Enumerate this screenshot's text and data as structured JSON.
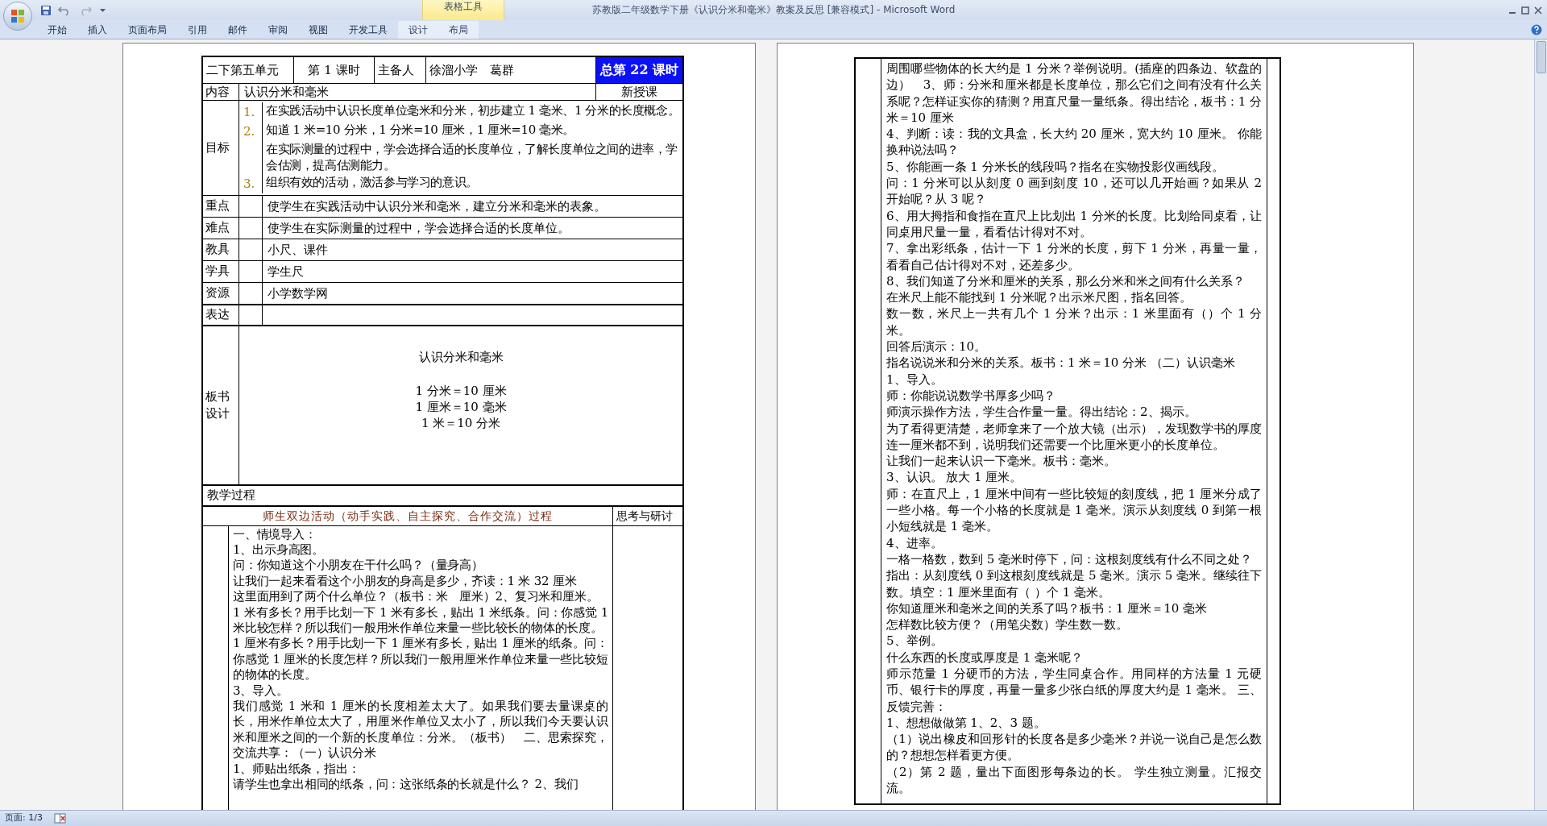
{
  "window": {
    "title": "苏教版二年级数学下册《认识分米和毫米》教案及反思 [兼容模式] - Microsoft Word",
    "contextual_group": "表格工具"
  },
  "ribbon_tabs": [
    {
      "label": "开始",
      "kind": "standard",
      "selected": false
    },
    {
      "label": "插入",
      "kind": "standard",
      "selected": false
    },
    {
      "label": "页面布局",
      "kind": "standard",
      "selected": false
    },
    {
      "label": "引用",
      "kind": "standard",
      "selected": false
    },
    {
      "label": "邮件",
      "kind": "standard",
      "selected": false
    },
    {
      "label": "审阅",
      "kind": "standard",
      "selected": false
    },
    {
      "label": "视图",
      "kind": "standard",
      "selected": false
    },
    {
      "label": "开发工具",
      "kind": "standard",
      "selected": false
    },
    {
      "label": "设计",
      "kind": "contextual",
      "selected": false
    },
    {
      "label": "布局",
      "kind": "contextual",
      "selected": false
    }
  ],
  "left_page": {
    "header": [
      "二下第五单元",
      "第 1 课时",
      "主备人",
      "徐溜小学　葛群"
    ],
    "lesson_total": "总第 22 课时",
    "content_label": "内容",
    "content": "认识分米和毫米",
    "lesson_type": "新授课",
    "goals_label": "目标",
    "goals": [
      {
        "number": "1.",
        "text": "在实践活动中认识长度单位毫米和分米，初步建立 1 毫米、1 分米的长度概念。"
      },
      {
        "number": "2.",
        "text": "知道 1 米=10 分米，1 分米=10 厘米，1 厘米=10 毫米。"
      },
      {
        "text": "在实际测量的过程中，学会选择合适的长度单位，了解长度单位之间的进率，学会估测，提高估测能力。"
      },
      {
        "number": "3.",
        "text": "组织有效的活动，激活参与学习的意识。"
      }
    ],
    "rows": [
      {
        "label": "重点",
        "text": "使学生在实践活动中认识分米和毫米，建立分米和毫米的表象。"
      },
      {
        "label": "难点",
        "text": "使学生在实际测量的过程中，学会选择合适的长度单位。"
      },
      {
        "label": "教具",
        "text": "小尺、课件"
      },
      {
        "label": "学具",
        "text": "学生尺"
      },
      {
        "label": "资源",
        "text": "小学数学网"
      },
      {
        "label": "表达"
      }
    ],
    "board": {
      "label": "板书设计",
      "title": "认识分米和毫米",
      "lines": [
        "1 分米＝10 厘米",
        "1 厘米＝10 毫米",
        "1 米＝10 分米"
      ]
    },
    "process": {
      "title": "教学过程",
      "activity_heading": "师生双边活动（动手实践、自主探究、合作交流）过程",
      "reflection_heading": "思考与研讨",
      "paragraphs": [
        "一、情境导入：",
        "1、出示身高图。",
        "问：你知道这个小朋友在干什么吗？（量身高）",
        "让我们一起来看看这个小朋友的身高是多少，齐读：1 米 32 厘米",
        "这里面用到了两个什么单位？（板书：米　厘米）2、复习米和厘米。",
        "1 米有多长？用手比划一下 1 米有多长，贴出 1 米纸条。问：你感觉 1 米比较怎样？所以我们一般用米作单位来量一些比较长的物体的长度。",
        "1 厘米有多长？用手比划一下 1 厘米有多长，贴出 1 厘米的纸条。问：你感觉 1 厘米的长度怎样？所以我们一般用厘米作单位来量一些比较短的物体的长度。",
        "3、导入。",
        "我们感觉 1 米和 1 厘米的长度相差太大了。如果我们要去量课桌的长，用米作单位太大了，用厘米作单位又太小了，所以我们今天要认识米和厘米之间的一个新的长度单位：分米。（板书）　二、思索探究，交流共享：（一）认识分米",
        "1、师贴出纸条，指出：",
        "请学生也拿出相同的纸条，问：这张纸条的长就是什么？ 2、我们"
      ]
    }
  },
  "right_page": {
    "paragraphs": [
      "周围哪些物体的长大约是 1 分米？举例说明。(插座的四条边、软盘的边）　3、师：分米和厘米都是长度单位，那么它们之间有没有什么关系呢？怎样证实你的猜测？用直尺量一量纸条。得出结论，板书：1 分米＝10 厘米",
      "4、判断：读：我的文具盒，长大约 20 厘米，宽大约 10 厘米。 你能换种说法吗？",
      "5、你能画一条 1 分米长的线段吗？指名在实物投影仪画线段。",
      "问：1 分米可以从刻度 0 画到刻度 10，还可以几开始画？如果从 2 开始呢？从 3 呢？",
      "6、用大拇指和食指在直尺上比划出 1 分米的长度。比划给同桌看，让同桌用尺量一量，看看估计得对不对。",
      "7、拿出彩纸条，估计一下 1 分米的长度，剪下 1 分米，再量一量，看看自己估计得对不对，还差多少。",
      "8、我们知道了分米和厘米的关系，那么分米和米之间有什么关系？",
      "在米尺上能不能找到 1 分米呢？出示米尺图，指名回答。",
      "数一数，米尺上一共有几个 1 分米？出示：1 米里面有（）个 1 分米。",
      "回答后演示：10。",
      "指名说说米和分米的关系。板书：1 米＝10 分米 （二）认识毫米",
      "1、导入。",
      "师：你能说说数学书厚多少吗？",
      "师演示操作方法，学生合作量一量。得出结论：2、揭示。",
      "为了看得更清楚，老师拿来了一个放大镜（出示），发现数学书的厚度连一厘米都不到，说明我们还需要一个比厘米更小的长度单位。",
      "让我们一起来认识一下毫米。板书：毫米。",
      "3、认识。 放大 1 厘米。",
      "师：在直尺上，1 厘米中间有一些比较短的刻度线，把 1 厘米分成了一些小格。每一个小格的长度就是 1 毫米。演示从刻度线 0 到第一根小短线就是 1 毫米。",
      "4、进率。",
      "一格一格数，数到 5 毫米时停下，问：这根刻度线有什么不同之处？",
      "指出：从刻度线 0 到这根刻度线就是 5 毫米。演示 5 毫米。继续往下数。填空：1 厘米里面有（ ）个 1 毫米。",
      "你知道厘米和毫米之间的关系了吗？板书：1 厘米＝10 毫米",
      "怎样数比较方便？（用笔尖数）学生数一数。",
      "5、举例。",
      "什么东西的长度或厚度是 1 毫米呢？",
      "师示范量 1 分硬币的方法，学生同桌合作。用同样的方法量 1 元硬币、银行卡的厚度，再量一量多少张白纸的厚度大约是 1 毫米。 三、反馈完善：",
      "1、想想做做第 1、2、3 题。",
      "（1）说出橡皮和回形针的长度各是多少毫米？并说一说自己是怎么数的？想想怎样看更方便。",
      "（2）第 2 题，量出下面图形每条边的长。 学生独立测量。汇报交流。"
    ]
  },
  "status_bar": {
    "page": "页面: 1/3"
  }
}
